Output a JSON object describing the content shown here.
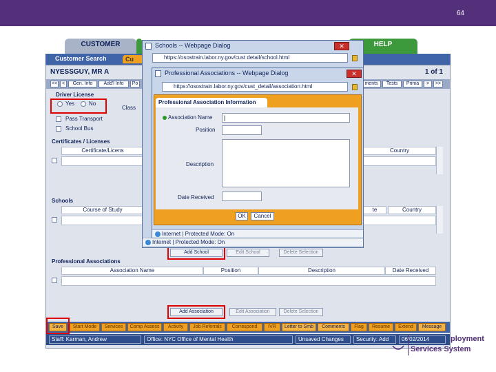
{
  "slide_number": "64",
  "tabs": {
    "customer": "CUSTOMER",
    "help": "HELP"
  },
  "subbar": {
    "customer_search": "Customer Search",
    "cu_tab": "Cu"
  },
  "customer": {
    "name": "NYESSGUY, MR A",
    "pager": "1 of 1"
  },
  "nav_buttons": {
    "first": "<<",
    "prev": "<",
    "gen_info": "Gen. Info",
    "add_info": "Add'l Info",
    "po": "Po",
    "ments": "ments",
    "tests": "Tests",
    "prima": "Prima",
    "next": ">",
    "last": ">>"
  },
  "driver_license": {
    "label": "Driver License",
    "yes": "Yes",
    "no": "No",
    "class_label": "Class"
  },
  "checks": {
    "pass_transport": "Pass Transport",
    "school_bus": "School Bus"
  },
  "certificates": {
    "label": "Certificates / Licenses",
    "col_cert": "Certificate/Licens",
    "col_country": "Country"
  },
  "schools": {
    "label": "Schools",
    "col_course": "Course of Study",
    "col_te": "te",
    "col_country": "Country"
  },
  "school_buttons": {
    "add": "Add School",
    "edit": "Edit School",
    "delete": "Delete Selection"
  },
  "prof_assoc": {
    "label": "Professional Associations",
    "columns": [
      "Association Name",
      "Position",
      "Description",
      "Date Received"
    ]
  },
  "assoc_buttons": {
    "add": "Add Association",
    "edit": "Edit Association",
    "delete": "Delete Selection"
  },
  "bottom_buttons": [
    "Save",
    "Start Mode",
    "Services",
    "Comp Assess",
    "Activity",
    "Job Referrals",
    "Correspond",
    "IVR",
    "Letter to Smb",
    "Comments",
    "Flag",
    "Resume",
    "Extend",
    "Message"
  ],
  "statusbar": {
    "staff": "Staff: Karman, Andrew",
    "office": "Office: NYC Office of Mental Health",
    "unsaved": "Unsaved Changes",
    "security": "Security: Add",
    "date": "06/02/2014"
  },
  "schools_dialog": {
    "title": "Schools -- Webpage Dialog",
    "close": "✕",
    "url": "https://osostrain.labor.ny.gov/cust detail/school.html",
    "status": "Internet | Protected Mode: On"
  },
  "assoc_dialog": {
    "title": "Professional Associations -- Webpage Dialog",
    "close": "✕",
    "url": "https://osostrain.labor.ny.gov/cust_detail/association.html",
    "panel_title": "Professional Association Information",
    "fields": {
      "name_label": "Association Name",
      "name_value": "|",
      "position_label": "Position",
      "description_label": "Description",
      "date_label": "Date Received"
    },
    "ok": "OK",
    "cancel": "Cancel",
    "status": "Internet | Protected Mode: On"
  },
  "logo_text": {
    "line1": "ployment",
    "line2": "Services System"
  },
  "colors": {
    "brand_purple": "#55307a",
    "accent_red": "#e00000",
    "nav_blue": "#3f64a8",
    "orange": "#f0a020"
  }
}
